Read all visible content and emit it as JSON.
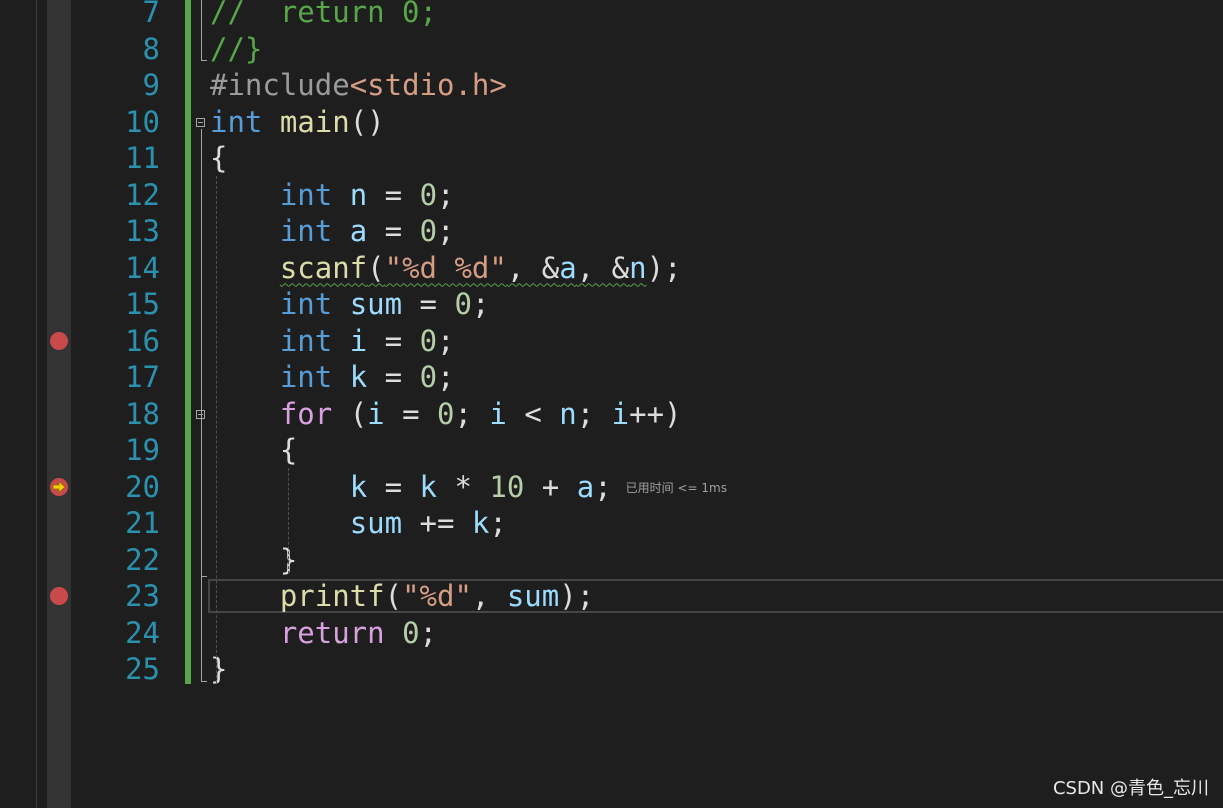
{
  "editor": {
    "lines": [
      {
        "number": "7",
        "tokens": [
          {
            "t": "//  return 0;",
            "c": "comment"
          }
        ]
      },
      {
        "number": "8",
        "tokens": [
          {
            "t": "//}",
            "c": "comment"
          }
        ]
      },
      {
        "number": "9",
        "tokens": [
          {
            "t": "#include",
            "c": "preproc"
          },
          {
            "t": "<stdio.h>",
            "c": "string"
          }
        ]
      },
      {
        "number": "10",
        "tokens": [
          {
            "t": "int",
            "c": "keyword"
          },
          {
            "t": " ",
            "c": "punct"
          },
          {
            "t": "main",
            "c": "func"
          },
          {
            "t": "()",
            "c": "punct"
          }
        ]
      },
      {
        "number": "11",
        "tokens": [
          {
            "t": "{",
            "c": "punct"
          }
        ]
      },
      {
        "number": "12",
        "tokens": [
          {
            "t": "    ",
            "c": "punct"
          },
          {
            "t": "int",
            "c": "keyword"
          },
          {
            "t": " ",
            "c": "punct"
          },
          {
            "t": "n",
            "c": "ident"
          },
          {
            "t": " = ",
            "c": "punct"
          },
          {
            "t": "0",
            "c": "number"
          },
          {
            "t": ";",
            "c": "punct"
          }
        ]
      },
      {
        "number": "13",
        "tokens": [
          {
            "t": "    ",
            "c": "punct"
          },
          {
            "t": "int",
            "c": "keyword"
          },
          {
            "t": " ",
            "c": "punct"
          },
          {
            "t": "a",
            "c": "ident"
          },
          {
            "t": " = ",
            "c": "punct"
          },
          {
            "t": "0",
            "c": "number"
          },
          {
            "t": ";",
            "c": "punct"
          }
        ]
      },
      {
        "number": "14",
        "tokens": [
          {
            "t": "    ",
            "c": "punct"
          },
          {
            "t": "scanf",
            "c": "func squiggle"
          },
          {
            "t": "(",
            "c": "punct squiggle"
          },
          {
            "t": "\"%d %d\"",
            "c": "string squiggle"
          },
          {
            "t": ", ",
            "c": "punct squiggle"
          },
          {
            "t": "&",
            "c": "punct squiggle"
          },
          {
            "t": "a",
            "c": "ident squiggle"
          },
          {
            "t": ", ",
            "c": "punct squiggle"
          },
          {
            "t": "&",
            "c": "punct squiggle"
          },
          {
            "t": "n",
            "c": "ident squiggle"
          },
          {
            "t": ")",
            "c": "punct"
          },
          {
            "t": ";",
            "c": "punct"
          }
        ]
      },
      {
        "number": "15",
        "tokens": [
          {
            "t": "    ",
            "c": "punct"
          },
          {
            "t": "int",
            "c": "keyword"
          },
          {
            "t": " ",
            "c": "punct"
          },
          {
            "t": "sum",
            "c": "ident"
          },
          {
            "t": " = ",
            "c": "punct"
          },
          {
            "t": "0",
            "c": "number"
          },
          {
            "t": ";",
            "c": "punct"
          }
        ]
      },
      {
        "number": "16",
        "tokens": [
          {
            "t": "    ",
            "c": "punct"
          },
          {
            "t": "int",
            "c": "keyword"
          },
          {
            "t": " ",
            "c": "punct"
          },
          {
            "t": "i",
            "c": "ident"
          },
          {
            "t": " = ",
            "c": "punct"
          },
          {
            "t": "0",
            "c": "number"
          },
          {
            "t": ";",
            "c": "punct"
          }
        ]
      },
      {
        "number": "17",
        "tokens": [
          {
            "t": "    ",
            "c": "punct"
          },
          {
            "t": "int",
            "c": "keyword"
          },
          {
            "t": " ",
            "c": "punct"
          },
          {
            "t": "k",
            "c": "ident"
          },
          {
            "t": " = ",
            "c": "punct"
          },
          {
            "t": "0",
            "c": "number"
          },
          {
            "t": ";",
            "c": "punct"
          }
        ]
      },
      {
        "number": "18",
        "tokens": [
          {
            "t": "    ",
            "c": "punct"
          },
          {
            "t": "for",
            "c": "control"
          },
          {
            "t": " (",
            "c": "punct"
          },
          {
            "t": "i",
            "c": "ident"
          },
          {
            "t": " = ",
            "c": "punct"
          },
          {
            "t": "0",
            "c": "number"
          },
          {
            "t": "; ",
            "c": "punct"
          },
          {
            "t": "i",
            "c": "ident"
          },
          {
            "t": " < ",
            "c": "punct"
          },
          {
            "t": "n",
            "c": "ident"
          },
          {
            "t": "; ",
            "c": "punct"
          },
          {
            "t": "i",
            "c": "ident"
          },
          {
            "t": "++)",
            "c": "punct"
          }
        ]
      },
      {
        "number": "19",
        "tokens": [
          {
            "t": "    {",
            "c": "punct"
          }
        ]
      },
      {
        "number": "20",
        "tokens": [
          {
            "t": "        ",
            "c": "punct"
          },
          {
            "t": "k",
            "c": "ident"
          },
          {
            "t": " = ",
            "c": "punct"
          },
          {
            "t": "k",
            "c": "ident"
          },
          {
            "t": " * ",
            "c": "punct"
          },
          {
            "t": "10",
            "c": "number"
          },
          {
            "t": " + ",
            "c": "punct"
          },
          {
            "t": "a",
            "c": "ident"
          },
          {
            "t": ";",
            "c": "punct"
          }
        ],
        "hint": "已用时间 <= 1ms"
      },
      {
        "number": "21",
        "tokens": [
          {
            "t": "        ",
            "c": "punct"
          },
          {
            "t": "sum",
            "c": "ident"
          },
          {
            "t": " += ",
            "c": "punct"
          },
          {
            "t": "k",
            "c": "ident"
          },
          {
            "t": ";",
            "c": "punct"
          }
        ]
      },
      {
        "number": "22",
        "tokens": [
          {
            "t": "    }",
            "c": "punct"
          }
        ]
      },
      {
        "number": "23",
        "tokens": [
          {
            "t": "    ",
            "c": "punct"
          },
          {
            "t": "printf",
            "c": "func"
          },
          {
            "t": "(",
            "c": "punct"
          },
          {
            "t": "\"%d\"",
            "c": "string"
          },
          {
            "t": ", ",
            "c": "punct"
          },
          {
            "t": "sum",
            "c": "ident"
          },
          {
            "t": ");",
            "c": "punct"
          }
        ]
      },
      {
        "number": "24",
        "tokens": [
          {
            "t": "    ",
            "c": "punct"
          },
          {
            "t": "return",
            "c": "control"
          },
          {
            "t": " ",
            "c": "punct"
          },
          {
            "t": "0",
            "c": "number"
          },
          {
            "t": ";",
            "c": "punct"
          }
        ]
      },
      {
        "number": "25",
        "tokens": [
          {
            "t": "}",
            "c": "punct"
          }
        ]
      }
    ],
    "breakpoints": [
      "16",
      "23"
    ],
    "execution_line": "20",
    "current_line": "23",
    "fold_lines": [
      "10",
      "18"
    ]
  },
  "icons": {
    "breakpoint": "breakpoint-icon",
    "execution": "execution-pointer-icon",
    "fold": "fold-collapse-icon"
  },
  "colors": {
    "background": "#1e1e1e",
    "line_number": "#2b91af",
    "keyword": "#569cd6",
    "control": "#d8a0df",
    "string": "#d69d85",
    "number": "#b5cea8",
    "comment": "#57a64a",
    "breakpoint": "#e51400",
    "change_bar": "#57a64a"
  },
  "watermark": "CSDN @青色_忘川"
}
